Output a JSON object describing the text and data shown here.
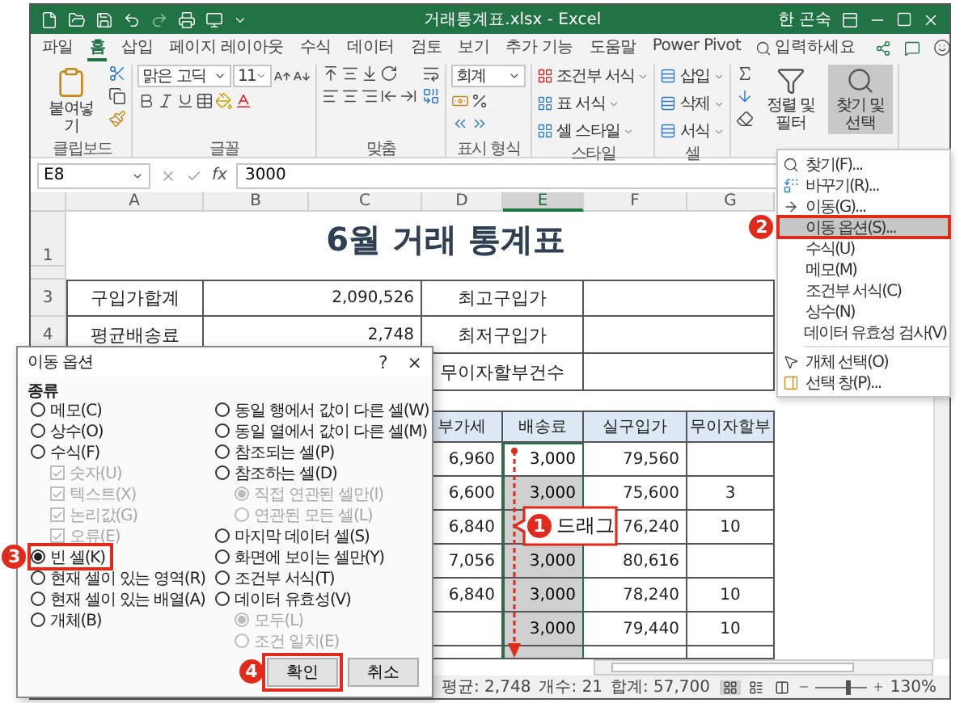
{
  "title_bar": {
    "document": "거래통계표.xlsx - Excel",
    "user": "한 곤숙"
  },
  "tabs": [
    {
      "label": "파일",
      "selected": false
    },
    {
      "label": "홈",
      "selected": true
    },
    {
      "label": "삽입",
      "selected": false
    },
    {
      "label": "페이지 레이아웃",
      "selected": false
    },
    {
      "label": "수식",
      "selected": false
    },
    {
      "label": "데이터",
      "selected": false
    },
    {
      "label": "검토",
      "selected": false
    },
    {
      "label": "보기",
      "selected": false
    },
    {
      "label": "추가 기능",
      "selected": false
    },
    {
      "label": "도움말",
      "selected": false
    },
    {
      "label": "Power Pivot",
      "selected": false
    }
  ],
  "tell_me": {
    "placeholder": "입력하세요"
  },
  "ribbon": {
    "clipboard": {
      "paste": "붙여넣기",
      "label": "클립보드"
    },
    "font": {
      "name": "맑은 고딕",
      "size": "11",
      "label": "글꼴"
    },
    "alignment": {
      "label": "맞춤"
    },
    "number": {
      "format": "회계",
      "label": "표시 형식"
    },
    "styles": {
      "items": [
        "조건부 서식",
        "표 서식",
        "셀 스타일"
      ],
      "label": "스타일"
    },
    "cells": {
      "items": [
        "삽입",
        "삭제",
        "서식"
      ],
      "label": "셀"
    },
    "editing": {
      "buttons": [
        {
          "label": "정렬 및 필터",
          "open": false
        },
        {
          "label": "찾기 및 선택",
          "open": true
        }
      ]
    }
  },
  "formula_bar": {
    "name_box": "E8",
    "function_label": "fx",
    "value": "3000"
  },
  "columns": [
    {
      "label": "A",
      "selected": false
    },
    {
      "label": "B",
      "selected": false
    },
    {
      "label": "C",
      "selected": false
    },
    {
      "label": "D",
      "selected": false
    },
    {
      "label": "E",
      "selected": true
    },
    {
      "label": "F",
      "selected": false
    },
    {
      "label": "G",
      "selected": false
    }
  ],
  "row_headers": [
    "1",
    "3",
    "4"
  ],
  "sheet_title": "6월 거래 통계표",
  "summary": [
    {
      "label": "구입가합계",
      "value": "2,090,526",
      "label_2": "최고구입가"
    },
    {
      "label": "평균배송료",
      "value": "2,748",
      "label_2": "최저구입가"
    },
    {
      "label_2": "무이자할부건수"
    }
  ],
  "table": {
    "columns": [
      "부가세",
      "배송료",
      "실구입가",
      "무이자할부"
    ],
    "rows": [
      {
        "vat": "6,960",
        "shipping": "3,000",
        "net_price": "79,560",
        "selected": true,
        "active": true
      },
      {
        "vat": "6,600",
        "shipping": "3,000",
        "net_price": "75,600",
        "installment": "3",
        "selected": true,
        "active": false
      },
      {
        "vat": "6,840",
        "net_price": "76,240",
        "installment": "10",
        "selected": true,
        "active": false
      },
      {
        "vat": "7,056",
        "shipping": "3,000",
        "net_price": "80,616",
        "selected": true,
        "active": false
      },
      {
        "vat": "6,840",
        "shipping": "3,000",
        "net_price": "78,240",
        "installment": "10",
        "selected": true,
        "active": false
      },
      {
        "shipping": "3,000",
        "net_price": "79,440",
        "installment": "10",
        "selected": true,
        "active": false
      },
      {
        "selected": true,
        "active": false
      }
    ]
  },
  "callout": {
    "number": "1",
    "text": "드래그"
  },
  "menu": {
    "sections": [
      [
        {
          "label": "찾기(F)...",
          "kind": "search",
          "selected": false
        },
        {
          "label": "바꾸기(R)...",
          "kind": "replace",
          "selected": false
        },
        {
          "label": "이동(G)...",
          "kind": "goto",
          "selected": false
        },
        {
          "label": "이동 옵션(S)...",
          "kind": "plain",
          "selected": true,
          "marker": "2"
        },
        {
          "label": "수식(U)",
          "kind": "plain",
          "selected": false
        },
        {
          "label": "메모(M)",
          "kind": "plain",
          "selected": false
        },
        {
          "label": "조건부 서식(C)",
          "kind": "plain",
          "selected": false
        },
        {
          "label": "상수(N)",
          "kind": "plain",
          "selected": false
        },
        {
          "label": "데이터 유효성 검사(V)",
          "kind": "plain",
          "selected": false
        }
      ],
      [
        {
          "label": "개체 선택(O)",
          "kind": "pointer",
          "selected": false
        },
        {
          "label": "선택 창(P)...",
          "kind": "pane",
          "selected": false
        }
      ]
    ]
  },
  "dialog": {
    "title": "이동 옵션",
    "help": "?",
    "close": "×",
    "group": "종류",
    "left": [
      {
        "label": "메모(C)",
        "kind": "radio",
        "selected": false,
        "disabled": false
      },
      {
        "label": "상수(O)",
        "kind": "radio",
        "selected": false,
        "disabled": false
      },
      {
        "label": "수식(F)",
        "kind": "radio",
        "selected": false,
        "disabled": false
      },
      {
        "label": "숫자(U)",
        "kind": "check",
        "checked": true,
        "disabled": true
      },
      {
        "label": "텍스트(X)",
        "kind": "check",
        "checked": true,
        "disabled": true
      },
      {
        "label": "논리값(G)",
        "kind": "check",
        "checked": true,
        "disabled": true
      },
      {
        "label": "오류(E)",
        "kind": "check",
        "checked": true,
        "disabled": true
      },
      {
        "label": "빈 셀(K)",
        "kind": "radio",
        "selected": true,
        "disabled": false,
        "marker": "3"
      },
      {
        "label": "현재 셀이 있는 영역(R)",
        "kind": "radio",
        "selected": false,
        "disabled": false
      },
      {
        "label": "현재 셀이 있는 배열(A)",
        "kind": "radio",
        "selected": false,
        "disabled": false
      },
      {
        "label": "개체(B)",
        "kind": "radio",
        "selected": false,
        "disabled": false
      }
    ],
    "right": [
      {
        "label": "동일 행에서 값이 다른 셀(W)",
        "kind": "radio",
        "selected": false,
        "disabled": false
      },
      {
        "label": "동일 열에서 값이 다른 셀(M)",
        "kind": "radio",
        "selected": false,
        "disabled": false
      },
      {
        "label": "참조되는 셀(P)",
        "kind": "radio",
        "selected": false,
        "disabled": false
      },
      {
        "label": "참조하는 셀(D)",
        "kind": "radio",
        "selected": false,
        "disabled": false
      },
      {
        "label": "직접 연관된 셀만(I)",
        "kind": "subradio",
        "selected": true,
        "disabled": true
      },
      {
        "label": "연관된 모든 셀(L)",
        "kind": "subradio",
        "selected": false,
        "disabled": true
      },
      {
        "label": "마지막 데이터 셀(S)",
        "kind": "radio",
        "selected": false,
        "disabled": false
      },
      {
        "label": "화면에 보이는 셀만(Y)",
        "kind": "radio",
        "selected": false,
        "disabled": false
      },
      {
        "label": "조건부 서식(T)",
        "kind": "radio",
        "selected": false,
        "disabled": false
      },
      {
        "label": "데이터 유효성(V)",
        "kind": "radio",
        "selected": false,
        "disabled": false
      },
      {
        "label": "모두(L)",
        "kind": "subradio",
        "selected": true,
        "disabled": true
      },
      {
        "label": "조건 일치(E)",
        "kind": "subradio",
        "selected": false,
        "disabled": true
      }
    ],
    "buttons": [
      {
        "label": "확인",
        "marker": "4"
      },
      {
        "label": "취소"
      }
    ]
  },
  "status_bar": {
    "items": [
      "평균: 2,748",
      "개수: 21",
      "합계: 57,700"
    ],
    "level": 0.6,
    "zoom": "130%"
  }
}
